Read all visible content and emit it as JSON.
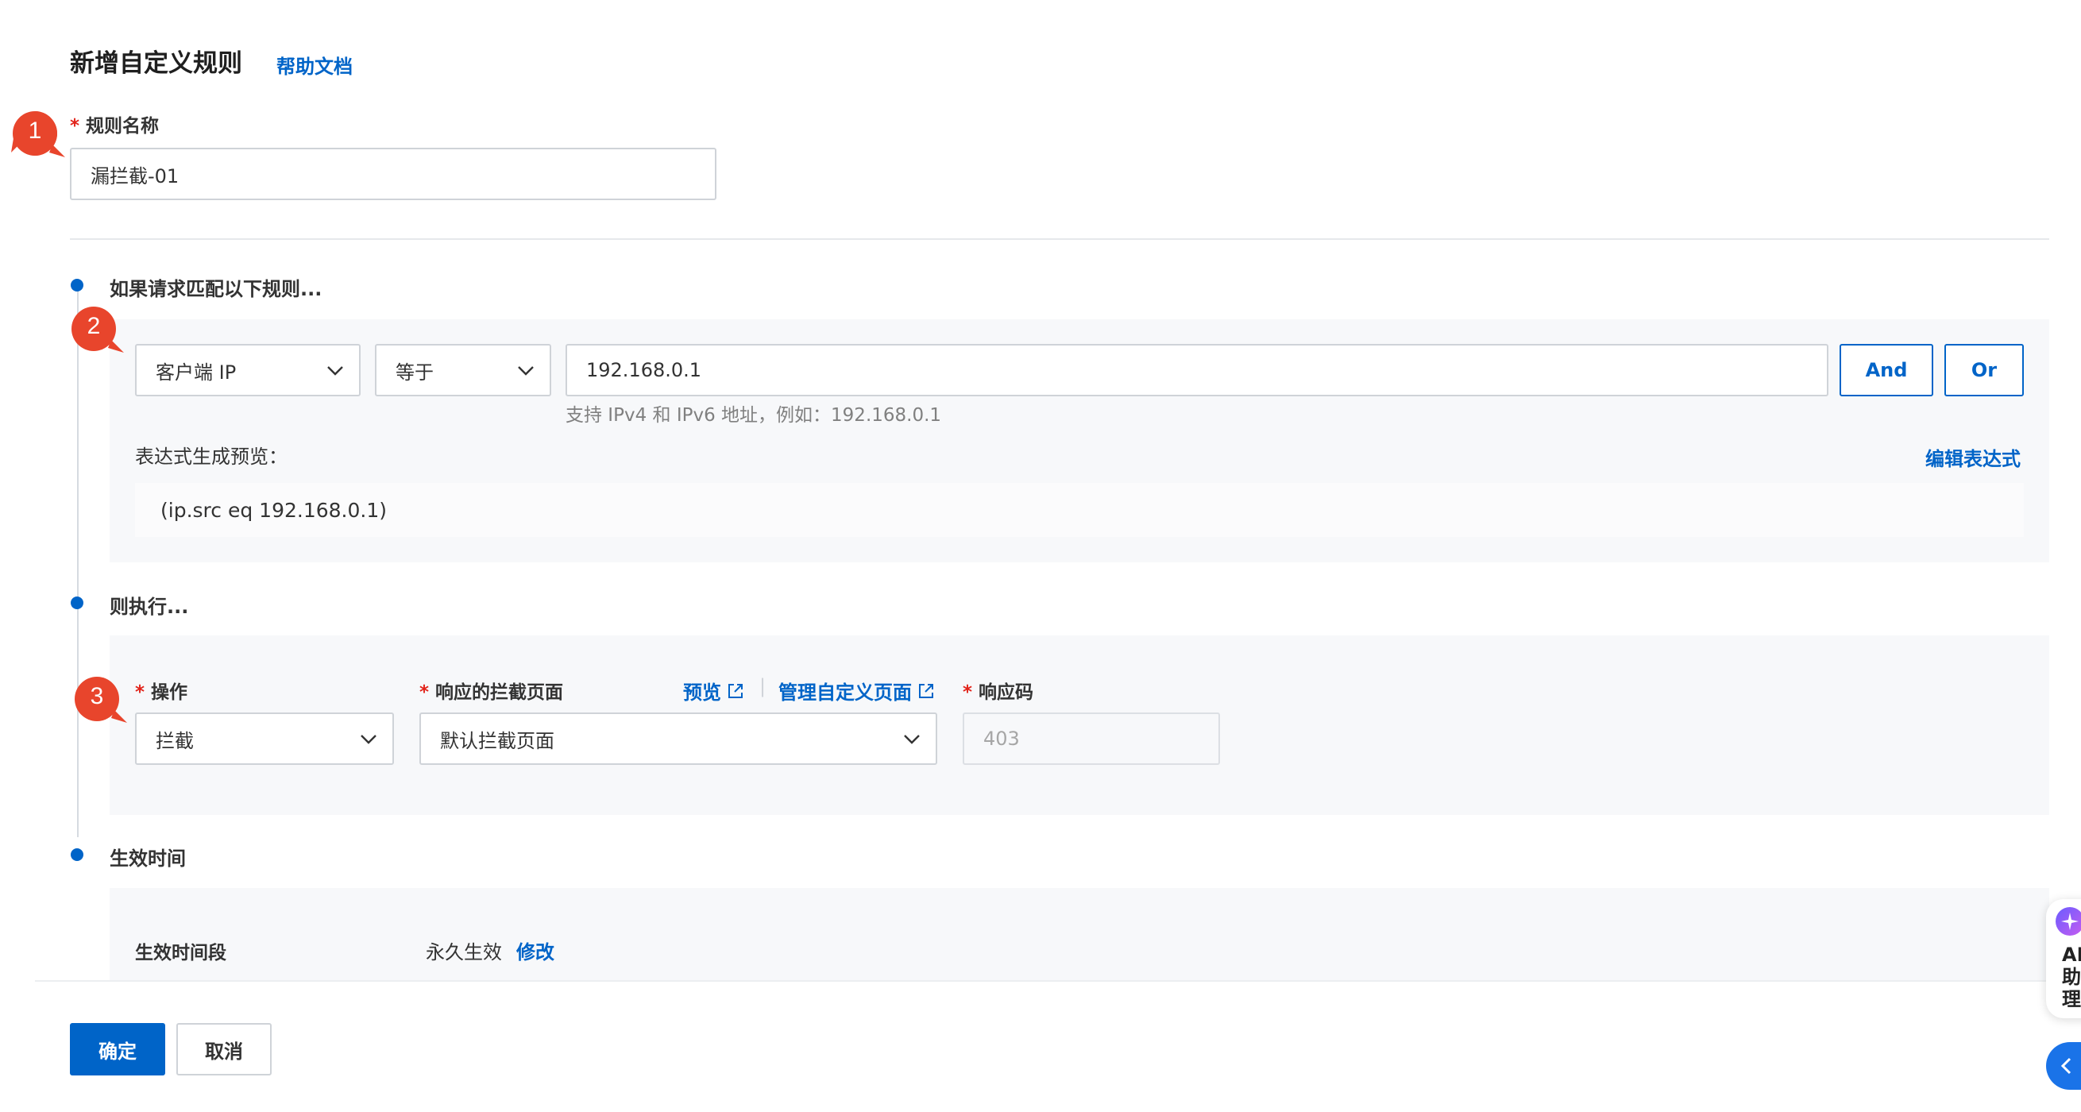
{
  "header": {
    "title": "新增自定义规则",
    "help_link": "帮助文档"
  },
  "steps": [
    "1",
    "2",
    "3"
  ],
  "rule_name": {
    "label": "规则名称",
    "required_mark": "*",
    "value": "漏拦截-01"
  },
  "match": {
    "section_title": "如果请求匹配以下规则...",
    "field_select": "客户端 IP",
    "operator_select": "等于",
    "value_input": "192.168.0.1",
    "hint": "支持 IPv4 和 IPv6 地址，例如：192.168.0.1",
    "and_button": "And",
    "or_button": "Or",
    "preview_label": "表达式生成预览：",
    "edit_expression_link": "编辑表达式",
    "expression": "(ip.src eq 192.168.0.1)"
  },
  "action": {
    "section_title": "则执行...",
    "operation_label": "操作",
    "operation_value": "拦截",
    "block_page_label": "响应的拦截页面",
    "preview_link": "预览",
    "separator": "|",
    "manage_pages_link": "管理自定义页面",
    "block_page_value": "默认拦截页面",
    "response_code_label": "响应码",
    "response_code_value": "403"
  },
  "effective_time": {
    "section_title": "生效时间",
    "period_label": "生效时间段",
    "period_value": "永久生效",
    "modify_link": "修改"
  },
  "footer": {
    "confirm_button": "确定",
    "cancel_button": "取消"
  },
  "ai_assistant": {
    "label_line1": "AI",
    "label_line2": "助",
    "label_line3": "理"
  },
  "colors": {
    "accent": "#0064c8",
    "badge": "#e8452c",
    "required": "#e2231a"
  }
}
